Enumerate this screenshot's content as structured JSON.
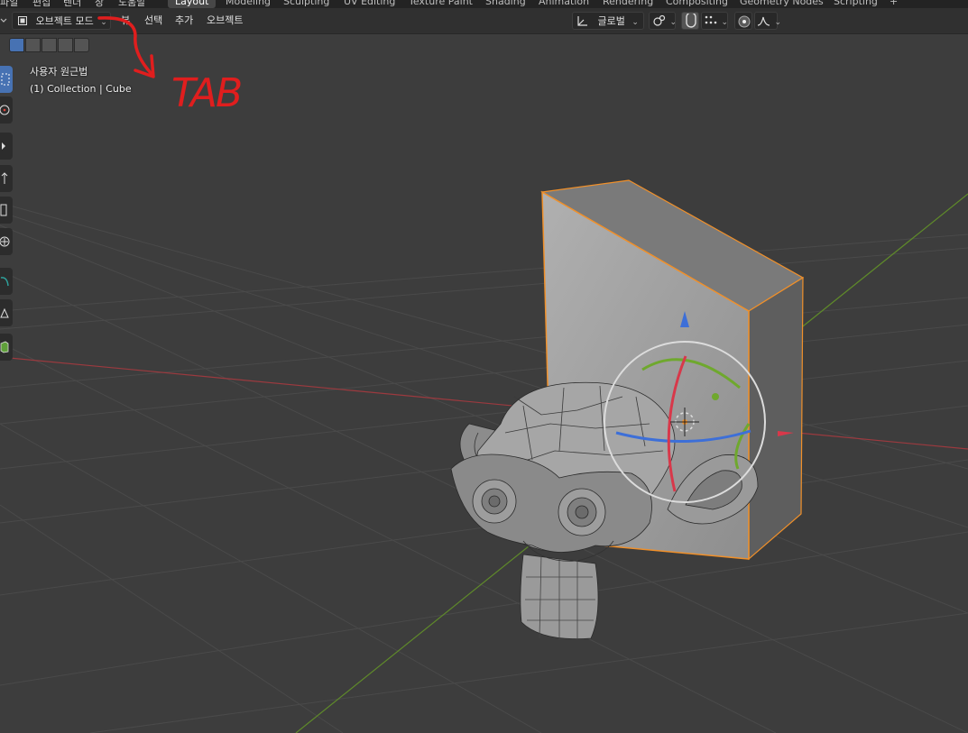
{
  "top_bar": {
    "menus": [
      "파일",
      "편집",
      "렌더",
      "창",
      "도움말"
    ],
    "tabs": [
      "Layout",
      "Modeling",
      "Sculpting",
      "UV Editing",
      "Texture Paint",
      "Shading",
      "Animation",
      "Rendering",
      "Compositing",
      "Geometry Nodes",
      "Scripting"
    ],
    "active_tab": "Layout",
    "add_label": "+"
  },
  "header": {
    "mode_label": "오브젝트 모드",
    "menu_view": "뷰",
    "menu_select": "선택",
    "menu_add": "추가",
    "menu_object": "오브젝트",
    "transform_orientation": "글로벌"
  },
  "viewport_info": {
    "perspective": "사용자 원근법",
    "collection": "(1) Collection | Cube"
  },
  "annotation": {
    "text": "TAB",
    "color": "#e01e1e"
  },
  "colors": {
    "viewport_bg": "#3d3d3d",
    "selection_outline": "#f0902a",
    "axis_x": "#c8323a",
    "axis_y": "#6e9b2a",
    "accent": "#4772b3"
  }
}
